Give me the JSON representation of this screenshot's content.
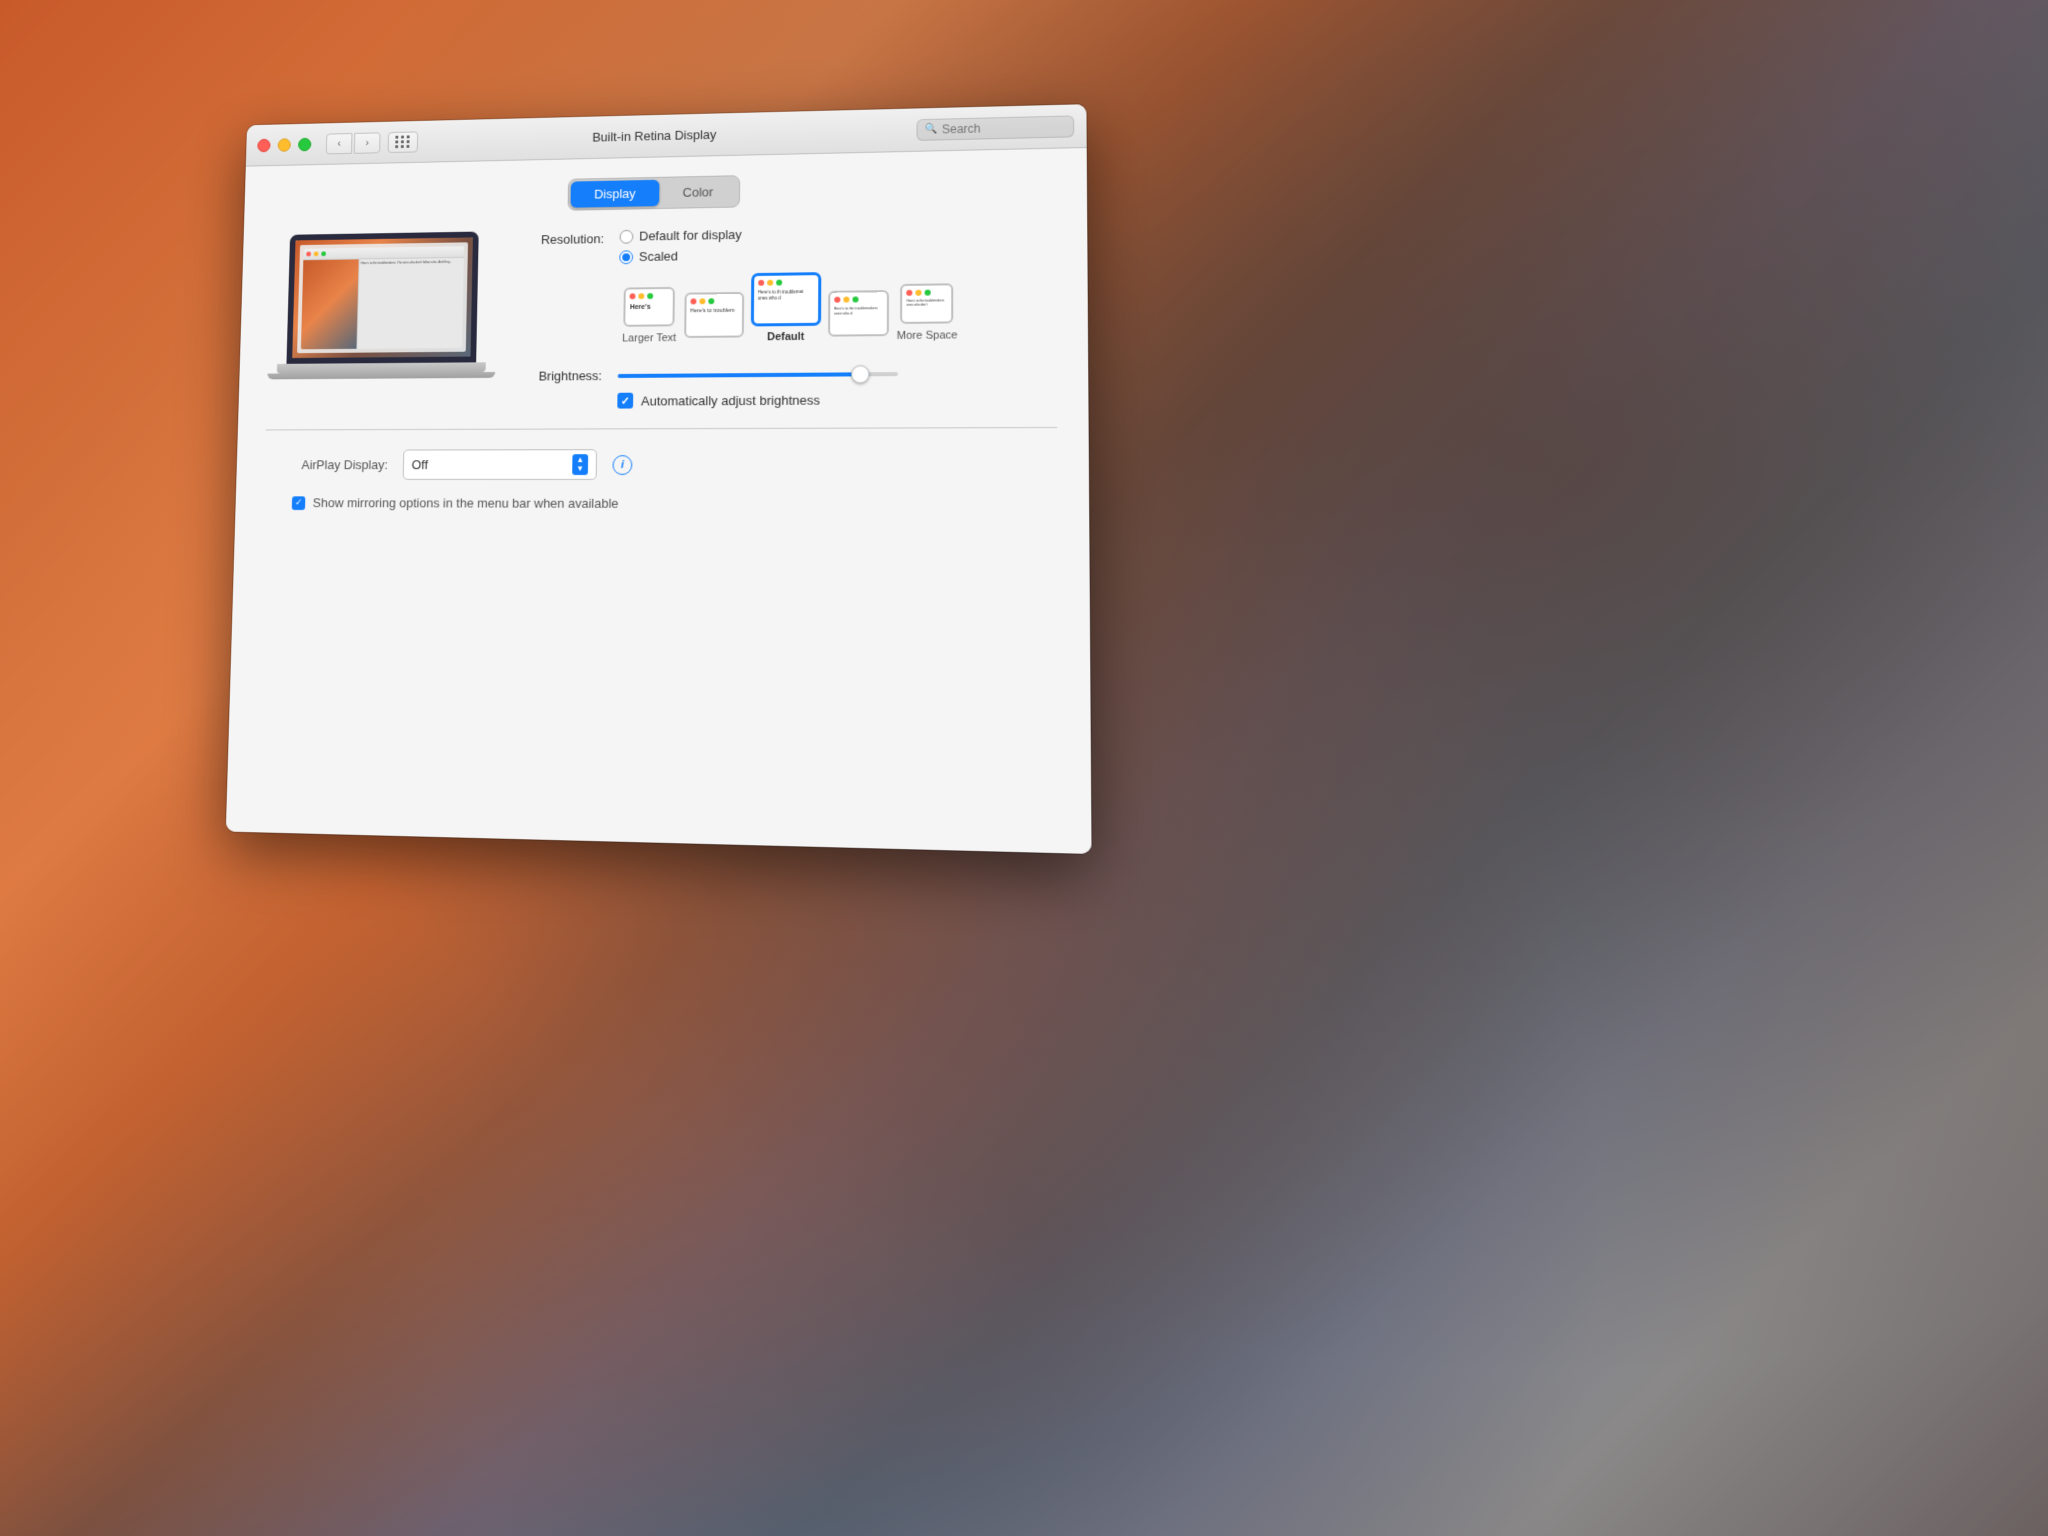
{
  "desktop": {
    "bg_desc": "macOS Yosemite wallpaper"
  },
  "window": {
    "title": "Built-in Retina Display",
    "search_placeholder": "Search"
  },
  "titlebar": {
    "close_label": "close",
    "minimize_label": "minimize",
    "maximize_label": "maximize",
    "back_arrow": "‹",
    "forward_arrow": "›"
  },
  "tabs": {
    "display_label": "Display",
    "color_label": "Color",
    "active": "display"
  },
  "resolution": {
    "label": "Resolution:",
    "option_default": "Default for display",
    "option_scaled": "Scaled",
    "selected": "scaled"
  },
  "scale_options": [
    {
      "id": "opt1",
      "label": "Larger Text",
      "text": "Here's",
      "selected": false
    },
    {
      "id": "opt2",
      "label": "",
      "text": "Here's to troublem",
      "selected": false
    },
    {
      "id": "opt3",
      "label": "Default",
      "text": "Here's to th troublemai ones who d",
      "selected": true
    },
    {
      "id": "opt4",
      "label": "",
      "text": "Here's to the troublemakers ones who d",
      "selected": false
    },
    {
      "id": "opt5",
      "label": "More Space",
      "text": "Here's to the troublemakers ones who don't",
      "selected": false
    }
  ],
  "brightness": {
    "label": "Brightness:",
    "value": 90,
    "auto_label": "Automatically adjust brightness",
    "auto_checked": true
  },
  "airplay": {
    "label": "AirPlay Display:",
    "value": "Off"
  },
  "mirror": {
    "label": "Show mirroring options in the menu bar when available",
    "checked": true
  }
}
